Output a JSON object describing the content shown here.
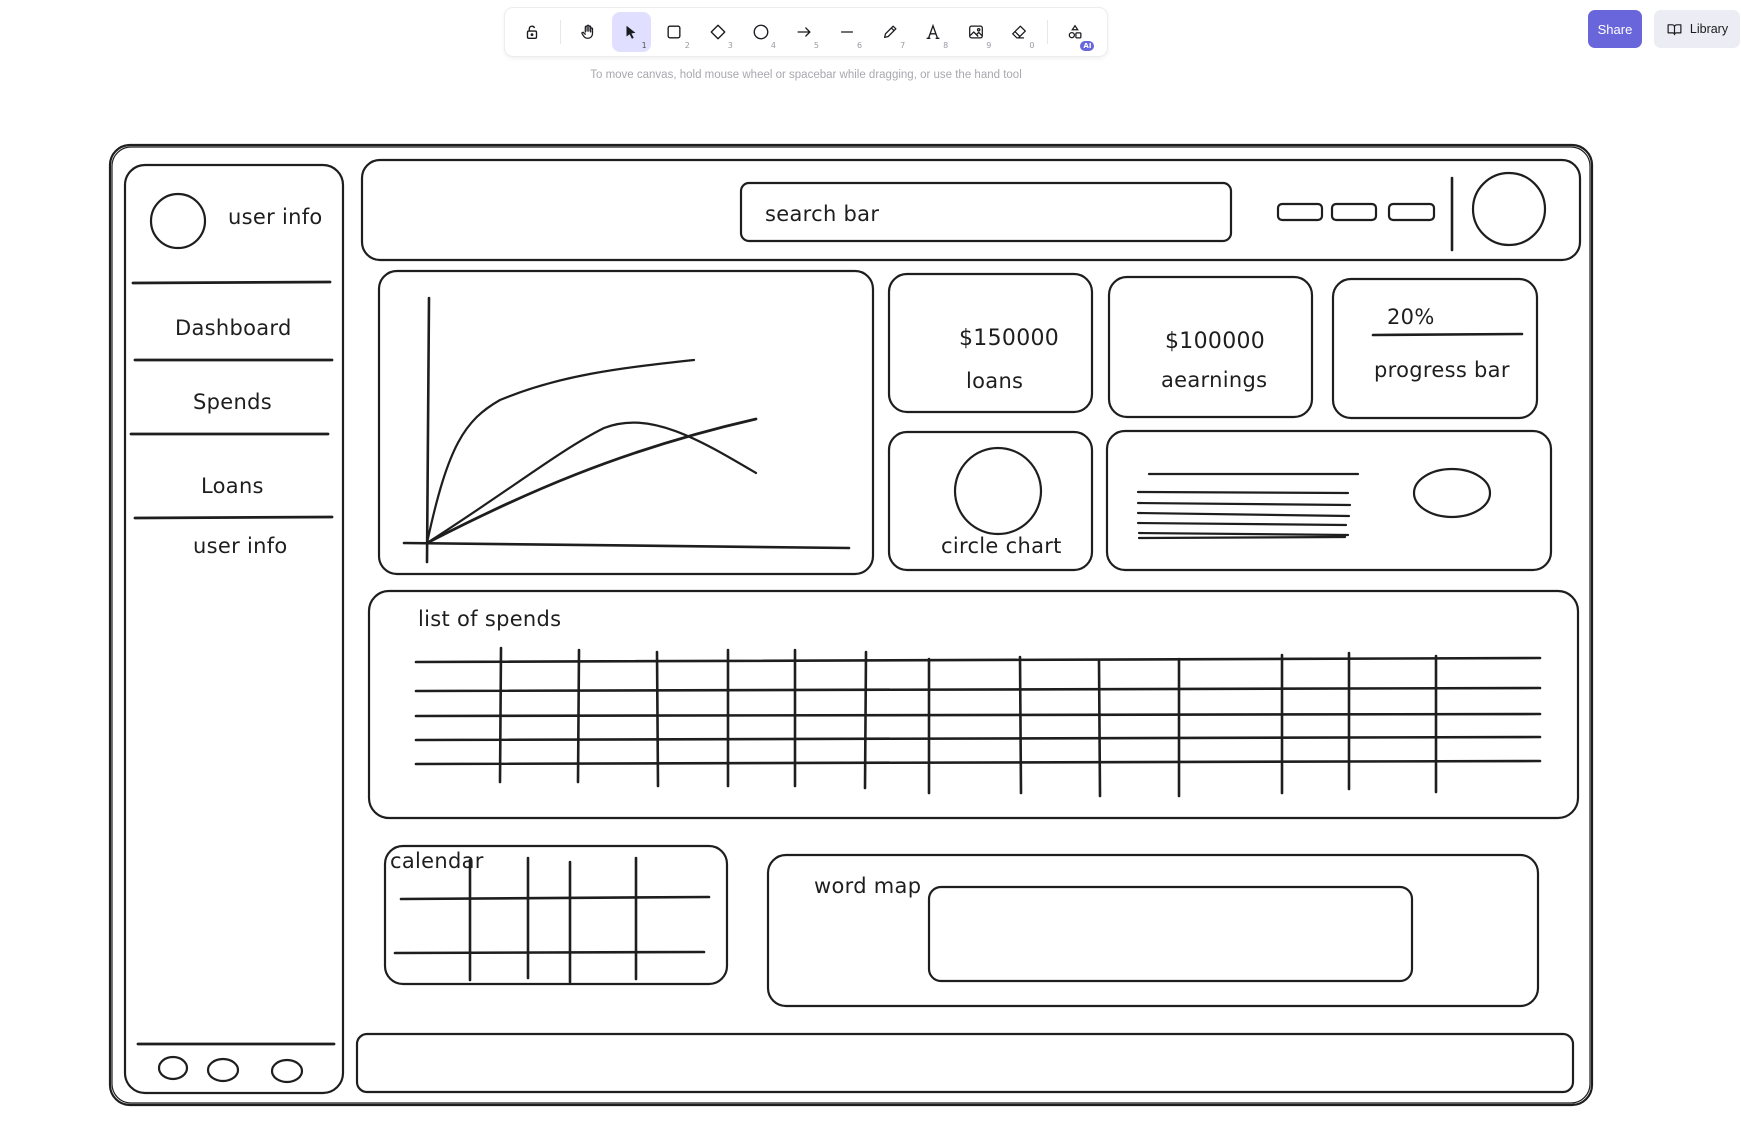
{
  "toolbar": {
    "tools": [
      {
        "name": "lock-tool",
        "icon": "lock-open-icon",
        "key": ""
      },
      {
        "name": "hand-tool",
        "icon": "hand-icon",
        "key": ""
      },
      {
        "name": "selection-tool",
        "icon": "cursor-arrow-icon",
        "key": "1",
        "active": true
      },
      {
        "name": "rectangle-tool",
        "icon": "square-icon",
        "key": "2"
      },
      {
        "name": "diamond-tool",
        "icon": "diamond-icon",
        "key": "3"
      },
      {
        "name": "ellipse-tool",
        "icon": "circle-icon",
        "key": "4"
      },
      {
        "name": "arrow-tool",
        "icon": "arrow-right-icon",
        "key": "5"
      },
      {
        "name": "line-tool",
        "icon": "line-icon",
        "key": "6"
      },
      {
        "name": "draw-tool",
        "icon": "pencil-icon",
        "key": "7"
      },
      {
        "name": "text-tool",
        "icon": "text-icon",
        "key": "8"
      },
      {
        "name": "image-tool",
        "icon": "image-icon",
        "key": "9"
      },
      {
        "name": "eraser-tool",
        "icon": "eraser-icon",
        "key": "0"
      },
      {
        "name": "more-shapes-tool",
        "icon": "shapes-icon",
        "key": "",
        "badge": "AI"
      }
    ],
    "hint": "To move canvas, hold mouse wheel or spacebar while dragging, or use the hand tool"
  },
  "header": {
    "share_label": "Share",
    "library_label": "Library"
  },
  "sketch": {
    "sidebar": {
      "user_info_top": "user info",
      "items": [
        "Dashboard",
        "Spends",
        "Loans",
        "user info"
      ]
    },
    "topbar": {
      "search": "search bar"
    },
    "cards": {
      "loans_value": "$150000",
      "loans_label": "loans",
      "earnings_value": "$100000",
      "earnings_label": "aearnings",
      "progress_value": "20%",
      "progress_label": "progress bar",
      "circle_label": "circle chart"
    },
    "spends_title": "list of spends",
    "calendar_title": "calendar",
    "word_map_title": "word map"
  },
  "colors": {
    "stroke": "#1e1e1e",
    "accent": "#6965db",
    "tool_active_bg": "#e0dfff"
  }
}
